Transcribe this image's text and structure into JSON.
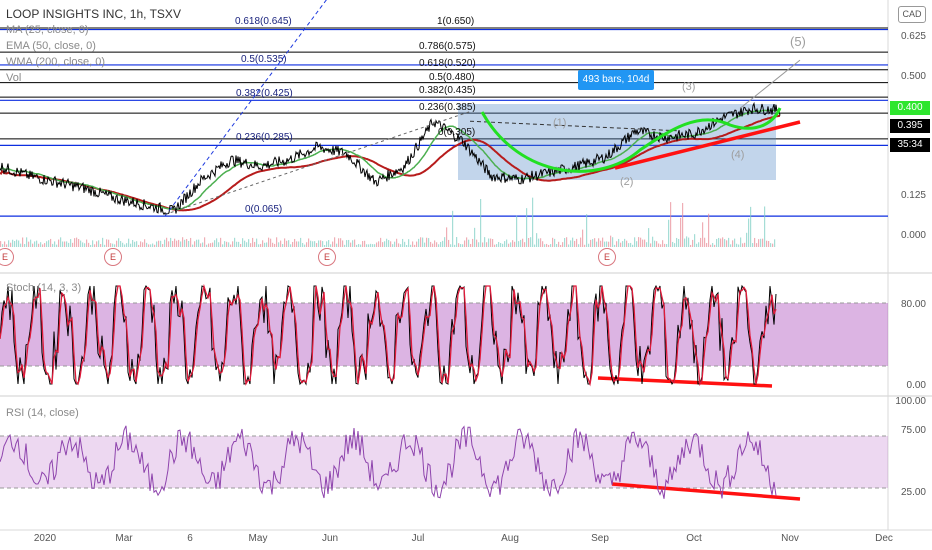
{
  "header": {
    "symbol": "LOOP INSIGHTS INC, 1h, TSXV",
    "currency": "CAD",
    "indicators": [
      "MA (25, close, 0)",
      "EMA (50, close, 0)",
      "WMA (200, close, 0)",
      "Vol"
    ],
    "stoch_label": "Stoch (14, 3, 3)",
    "rsi_label": "RSI (14, close)"
  },
  "tooltip": "493 bars, 104d",
  "price_tags": {
    "top": "0.400",
    "current": "0.395",
    "countdown": "35:34"
  },
  "fib_levels": [
    {
      "label": "1(0.650)",
      "black": true
    },
    {
      "label": "0.786(0.575)",
      "black": true
    },
    {
      "label": "0.618(0.520)",
      "black": true
    },
    {
      "label": "0.5(0.480)",
      "black": true
    },
    {
      "label": "0.382(0.435)",
      "black": true
    },
    {
      "label": "0.236(0.385)",
      "black": true
    },
    {
      "label": "0(0.305)",
      "black": true
    },
    {
      "label": "0.618(0.645)",
      "black": false
    },
    {
      "label": "0.5(0.535)",
      "black": false
    },
    {
      "label": "0.382(0.425)",
      "black": false
    },
    {
      "label": "0.236(0.285)",
      "black": false
    },
    {
      "label": "0(0.065)",
      "black": false
    }
  ],
  "waves": [
    "(5)",
    "(3)",
    "(1)",
    "(2)",
    "(4)"
  ],
  "earnings_marker": "E",
  "colors": {
    "ma": "#4caf50",
    "ema": "#b71c1c",
    "price": "#000000",
    "fib_blue": "#0d2ee0",
    "trend_red": "#ff1111",
    "trend_green": "#22e022",
    "stoch_bg": "#9c27b0",
    "rsi": "#8e44ad",
    "range_box": "#4f86c6"
  },
  "chart_data": [
    {
      "type": "line",
      "title": "LOOP INSIGHTS INC, 1h, TSXV",
      "x_ticks": [
        "2020",
        "Mar",
        "6",
        "May",
        "Jun",
        "Jul",
        "Aug",
        "Sep",
        "Oct",
        "Nov",
        "Dec"
      ],
      "y_ticks": [
        "0.625",
        "0.500",
        "0.400",
        "0.395",
        "0.125",
        "0.000"
      ],
      "ylim": [
        -0.05,
        0.7
      ],
      "series": [
        {
          "name": "Price",
          "values": [
            0.22,
            0.19,
            0.17,
            0.15,
            0.12,
            0.1,
            0.08,
            0.18,
            0.24,
            0.22,
            0.24,
            0.28,
            0.26,
            0.17,
            0.22,
            0.36,
            0.3,
            0.19,
            0.18,
            0.2,
            0.22,
            0.25,
            0.33,
            0.31,
            0.32,
            0.37,
            0.4,
            0.395
          ]
        }
      ]
    },
    {
      "type": "line",
      "title": "Stoch (14, 3, 3)",
      "y_ticks": [
        "80.00",
        "0.00"
      ],
      "ylim": [
        0,
        100
      ]
    },
    {
      "type": "line",
      "title": "RSI (14, close)",
      "y_ticks": [
        "100.00",
        "75.00",
        "25.00"
      ],
      "ylim": [
        0,
        100
      ]
    }
  ]
}
